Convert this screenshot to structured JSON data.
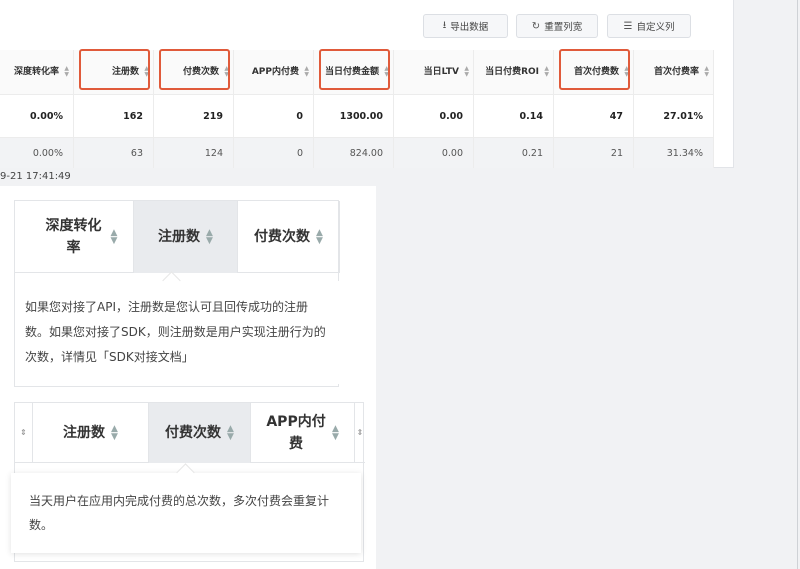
{
  "toolbar": {
    "export_label": "导出数据",
    "reset_label": "重置列宽",
    "custom_label": "自定义列"
  },
  "table": {
    "headers": [
      "深度转化率",
      "注册数",
      "付费次数",
      "APP内付费",
      "当日付费金额",
      "当日LTV",
      "当日付费ROI",
      "首次付费数",
      "首次付费率"
    ],
    "highlighted": [
      "注册数",
      "付费次数",
      "当日付费金额",
      "首次付费数"
    ],
    "rows": [
      [
        "0.00%",
        "162",
        "219",
        "0",
        "1300.00",
        "0.00",
        "0.14",
        "47",
        "27.01%"
      ],
      [
        "0.00%",
        "63",
        "124",
        "0",
        "824.00",
        "0.00",
        "0.21",
        "21",
        "31.34%"
      ]
    ]
  },
  "timestamp": "9-21 17:41:49",
  "zoom1": {
    "col1": "深度转化率",
    "col2": "注册数",
    "col3": "付费次数",
    "tooltip": "如果您对接了API，注册数是您认可且回传成功的注册数。如果您对接了SDK，则注册数是用户实现注册行为的次数，详情见「SDK对接文档」"
  },
  "zoom2": {
    "col1": "注册数",
    "col2": "付费次数",
    "col3": "APP内付费",
    "tooltip": "当天用户在应用内完成付费的总次数，多次付费会重复计数。"
  }
}
